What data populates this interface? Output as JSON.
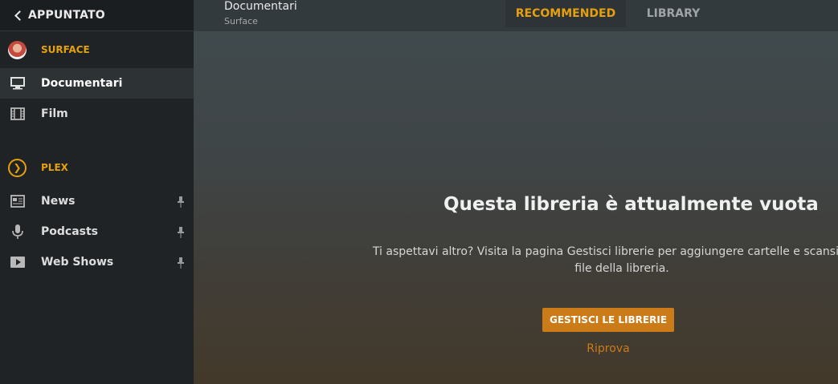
{
  "sidebar": {
    "back_label": "APPUNTATO",
    "sections": [
      {
        "label": "SURFACE",
        "icon": "avatar",
        "items": [
          {
            "label": "Documentari",
            "icon": "monitor-icon",
            "active": true,
            "pinned": false
          },
          {
            "label": "Film",
            "icon": "film-icon",
            "active": false,
            "pinned": false
          }
        ]
      },
      {
        "label": "PLEX",
        "icon": "plex-logo",
        "items": [
          {
            "label": "News",
            "icon": "news-icon",
            "active": false,
            "pinned": true
          },
          {
            "label": "Podcasts",
            "icon": "microphone-icon",
            "active": false,
            "pinned": true
          },
          {
            "label": "Web Shows",
            "icon": "play-icon",
            "active": false,
            "pinned": true
          }
        ]
      }
    ]
  },
  "header": {
    "title": "Documentari",
    "subtitle": "Surface",
    "tabs": [
      {
        "label": "RECOMMENDED",
        "active": true
      },
      {
        "label": "LIBRARY",
        "active": false
      }
    ]
  },
  "empty_state": {
    "title": "Questa libreria è attualmente vuota",
    "description_line1": "Ti aspettavi altro? Visita la pagina Gestisci librerie per aggiungere cartelle e scansionare",
    "description_line2": "file della libreria.",
    "button_label": "GESTISCI LE LIBRERIE",
    "retry_label": "Riprova"
  },
  "colors": {
    "accent": "#e5a00d",
    "button": "#cc7b19",
    "sidebar_bg": "#1f2326"
  }
}
